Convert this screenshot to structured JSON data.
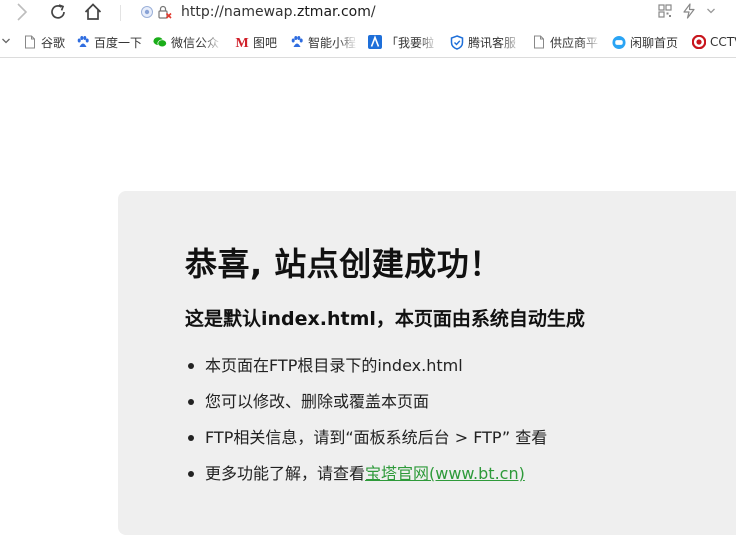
{
  "browser": {
    "url_prefix": "http://namewap.",
    "url_domain": "ztmar.com",
    "url_suffix": "/",
    "bookmarks": [
      {
        "label": "谷歌",
        "icon": "page-icon"
      },
      {
        "label": "百度一下",
        "icon": "baidu-paw-icon"
      },
      {
        "label": "微信公众",
        "icon": "wechat-icon"
      },
      {
        "label": "图吧",
        "icon": "m-logo-icon"
      },
      {
        "label": "智能小程",
        "icon": "baidu-paw-icon"
      },
      {
        "label": "「我要啦",
        "icon": "a-logo-icon"
      },
      {
        "label": "腾讯客服",
        "icon": "shield-icon"
      },
      {
        "label": "供应商平",
        "icon": "page-icon"
      },
      {
        "label": "闲聊首页",
        "icon": "chat-bubble-icon"
      },
      {
        "label": "CCTV",
        "icon": "cctv-logo-icon"
      }
    ]
  },
  "page": {
    "heading": "恭喜, 站点创建成功！",
    "subheading": "这是默认index.html，本页面由系统自动生成",
    "items": [
      {
        "text": "本页面在FTP根目录下的index.html"
      },
      {
        "text": "您可以修改、删除或覆盖本页面"
      },
      {
        "text": "FTP相关信息，请到“面板系统后台 > FTP” 查看"
      },
      {
        "text": "更多功能了解，请查看",
        "link": "宝塔官网(www.bt.cn)"
      }
    ],
    "link_color": "#2e9a3a",
    "card_color": "#efefef"
  }
}
